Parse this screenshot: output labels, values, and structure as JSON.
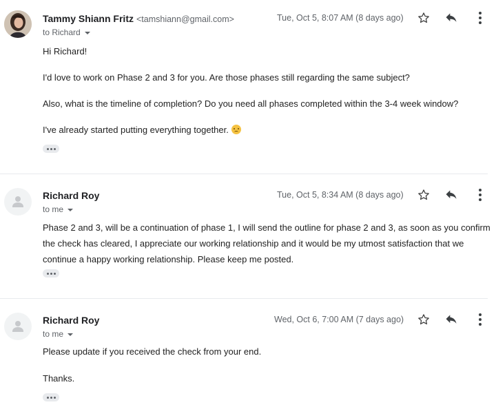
{
  "messages": [
    {
      "sender_name": "Tammy Shiann Fritz",
      "sender_email": "<tamshiann@gmail.com>",
      "recipient": "to Richard",
      "date": "Tue, Oct 5, 8:07 AM (8 days ago)",
      "avatar": "profile-photo",
      "body": [
        "Hi Richard!",
        "I'd love to work on Phase 2 and 3 for you. Are those phases still regarding the same subject?",
        "Also, what is the timeline of completion? Do you need all phases completed within the 3-4 week window?",
        "I've already started putting everything together."
      ],
      "emoji": "slightly-smiling-face"
    },
    {
      "sender_name": "Richard Roy",
      "recipient": "to me",
      "date": "Tue, Oct 5, 8:34 AM (8 days ago)",
      "avatar": "default-person",
      "body": [
        "Phase 2 and 3, will be a continuation of phase 1, I will send the outline for phase 2 and 3, as soon as you confirm the check has cleared, I appreciate our working relationship and it would be my utmost satisfaction that we continue a happy working relationship. Please keep me posted."
      ]
    },
    {
      "sender_name": "Richard Roy",
      "recipient": "to me",
      "date": "Wed, Oct 6, 7:00 AM (7 days ago)",
      "avatar": "default-person",
      "body": [
        "Please update if you received the check from your end.",
        "Thanks."
      ]
    }
  ],
  "icons": {
    "star": "star-outline-icon",
    "reply": "reply-arrow-icon",
    "more": "more-vertical-icon",
    "trimmed": "three-dots-icon"
  }
}
